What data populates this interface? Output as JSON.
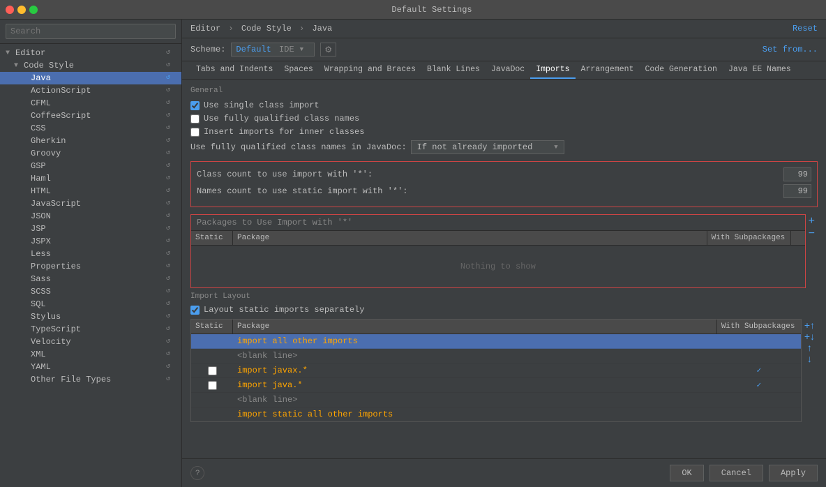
{
  "window": {
    "title": "Default Settings"
  },
  "sidebar": {
    "search_placeholder": "Search",
    "tree": {
      "editor_label": "Editor",
      "code_style_label": "Code Style",
      "items": [
        {
          "label": "Java",
          "selected": true
        },
        {
          "label": "ActionScript"
        },
        {
          "label": "CFML"
        },
        {
          "label": "CoffeeScript"
        },
        {
          "label": "CSS"
        },
        {
          "label": "Gherkin"
        },
        {
          "label": "Groovy"
        },
        {
          "label": "GSP"
        },
        {
          "label": "Haml"
        },
        {
          "label": "HTML"
        },
        {
          "label": "JavaScript"
        },
        {
          "label": "JSON"
        },
        {
          "label": "JSP"
        },
        {
          "label": "JSPX"
        },
        {
          "label": "Less"
        },
        {
          "label": "Properties"
        },
        {
          "label": "Sass"
        },
        {
          "label": "SCSS"
        },
        {
          "label": "SQL"
        },
        {
          "label": "Stylus"
        },
        {
          "label": "TypeScript"
        },
        {
          "label": "Velocity"
        },
        {
          "label": "XML"
        },
        {
          "label": "YAML"
        },
        {
          "label": "Other File Types"
        }
      ]
    }
  },
  "header": {
    "breadcrumb": {
      "part1": "Editor",
      "sep1": "›",
      "part2": "Code Style",
      "sep2": "›",
      "part3": "Java"
    },
    "reset_label": "Reset"
  },
  "scheme": {
    "label": "Scheme:",
    "name": "Default",
    "type": "IDE",
    "set_from_label": "Set from..."
  },
  "tabs": {
    "items": [
      {
        "label": "Tabs and Indents",
        "active": false
      },
      {
        "label": "Spaces",
        "active": false
      },
      {
        "label": "Wrapping and Braces",
        "active": false
      },
      {
        "label": "Blank Lines",
        "active": false
      },
      {
        "label": "JavaDoc",
        "active": false
      },
      {
        "label": "Imports",
        "active": true
      },
      {
        "label": "Arrangement",
        "active": false
      },
      {
        "label": "Code Generation",
        "active": false
      },
      {
        "label": "Java EE Names",
        "active": false
      }
    ]
  },
  "general": {
    "label": "General",
    "checkboxes": [
      {
        "label": "Use single class import",
        "checked": true
      },
      {
        "label": "Use fully qualified class names",
        "checked": false
      },
      {
        "label": "Insert imports for inner classes",
        "checked": false
      }
    ],
    "qualified_label": "Use fully qualified class names in JavaDoc:",
    "qualified_value": "If not already imported"
  },
  "import_counts": {
    "class_count_label": "Class count to use import with '*':",
    "class_count_value": "99",
    "names_count_label": "Names count to use static import with '*':",
    "names_count_value": "99"
  },
  "packages_section": {
    "label": "Packages to Use Import with '*'",
    "columns": {
      "static": "Static",
      "package": "Package",
      "with_subpackages": "With Subpackages"
    },
    "nothing_to_show": "Nothing to show",
    "add_btn": "+",
    "remove_btn": "−"
  },
  "import_layout": {
    "label": "Import Layout",
    "checkbox_label": "Layout static imports separately",
    "checked": true,
    "columns": {
      "static": "Static",
      "package": "Package",
      "with_subpackages": "With Subpackages"
    },
    "rows": [
      {
        "static_checked": null,
        "package": "import all other imports",
        "with_subpackages": "",
        "selected": true,
        "is_blank": false,
        "type": "orange"
      },
      {
        "static_checked": null,
        "package": "<blank line>",
        "with_subpackages": "",
        "selected": false,
        "is_blank": true,
        "type": "gray"
      },
      {
        "static_checked": false,
        "package": "import javax.*",
        "with_subpackages": "",
        "selected": false,
        "is_blank": false,
        "type": "orange",
        "subpkg_checked": true
      },
      {
        "static_checked": false,
        "package": "import java.*",
        "with_subpackages": "",
        "selected": false,
        "is_blank": false,
        "type": "orange",
        "subpkg_checked": true
      },
      {
        "static_checked": null,
        "package": "<blank line>",
        "with_subpackages": "",
        "selected": false,
        "is_blank": true,
        "type": "gray"
      },
      {
        "static_checked": null,
        "package": "import static all other imports",
        "with_subpackages": "",
        "selected": false,
        "is_blank": false,
        "type": "orange"
      }
    ],
    "side_btns": [
      "+↑",
      "+↓",
      "↑",
      "↓"
    ]
  },
  "footer": {
    "ok_label": "OK",
    "cancel_label": "Cancel",
    "apply_label": "Apply",
    "help_label": "?"
  }
}
